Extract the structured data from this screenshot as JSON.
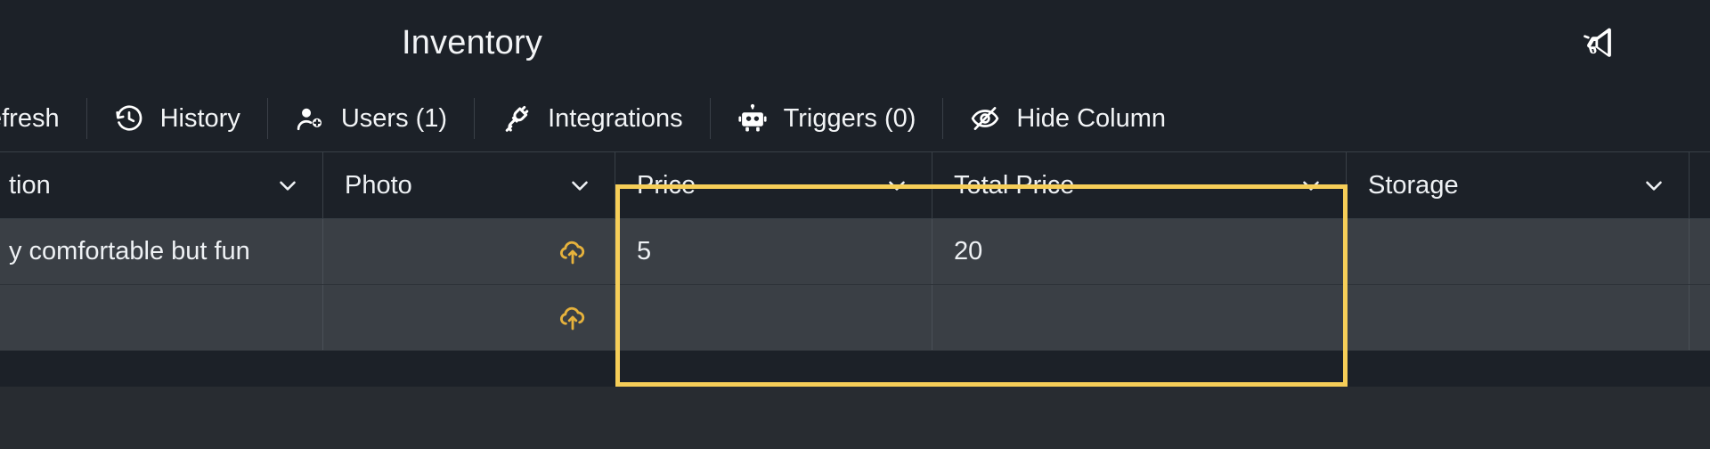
{
  "header": {
    "title": "Inventory",
    "announce_icon": "megaphone-icon"
  },
  "toolbar": {
    "items": [
      {
        "label": "efresh",
        "icon": "refresh-icon",
        "truncated": true
      },
      {
        "label": "History",
        "icon": "history-clock-icon"
      },
      {
        "label": "Users (1)",
        "icon": "user-add-icon"
      },
      {
        "label": "Integrations",
        "icon": "plug-icon"
      },
      {
        "label": "Triggers (0)",
        "icon": "robot-icon"
      },
      {
        "label": "Hide Column",
        "icon": "eye-off-icon",
        "truncated": true
      }
    ]
  },
  "table": {
    "columns": [
      {
        "label": "tion",
        "truncated": true,
        "sort_icon": "chevron-down-icon"
      },
      {
        "label": "Photo",
        "sort_icon": "chevron-down-icon"
      },
      {
        "label": "Price",
        "sort_icon": "chevron-down-icon"
      },
      {
        "label": "Total Price",
        "sort_icon": "chevron-down-icon"
      },
      {
        "label": "Storage",
        "sort_icon": "chevron-down-icon"
      }
    ],
    "rows": [
      {
        "description": "y comfortable but fun",
        "photo_icon": "cloud-upload-icon",
        "price": "5",
        "total_price": "20",
        "storage": ""
      },
      {
        "description": "",
        "photo_icon": "cloud-upload-icon",
        "price": "",
        "total_price": "",
        "storage": ""
      }
    ],
    "selection": {
      "columns": [
        "Price",
        "Total Price"
      ],
      "color": "#f6ce58"
    }
  },
  "colors": {
    "background": "#1c2128",
    "row_background": "#3a3f45",
    "below_grid": "#282c31",
    "text": "#eef1f4",
    "accent": "#f6ce58",
    "upload_icon": "#e6b23c",
    "divider": "#394047"
  }
}
